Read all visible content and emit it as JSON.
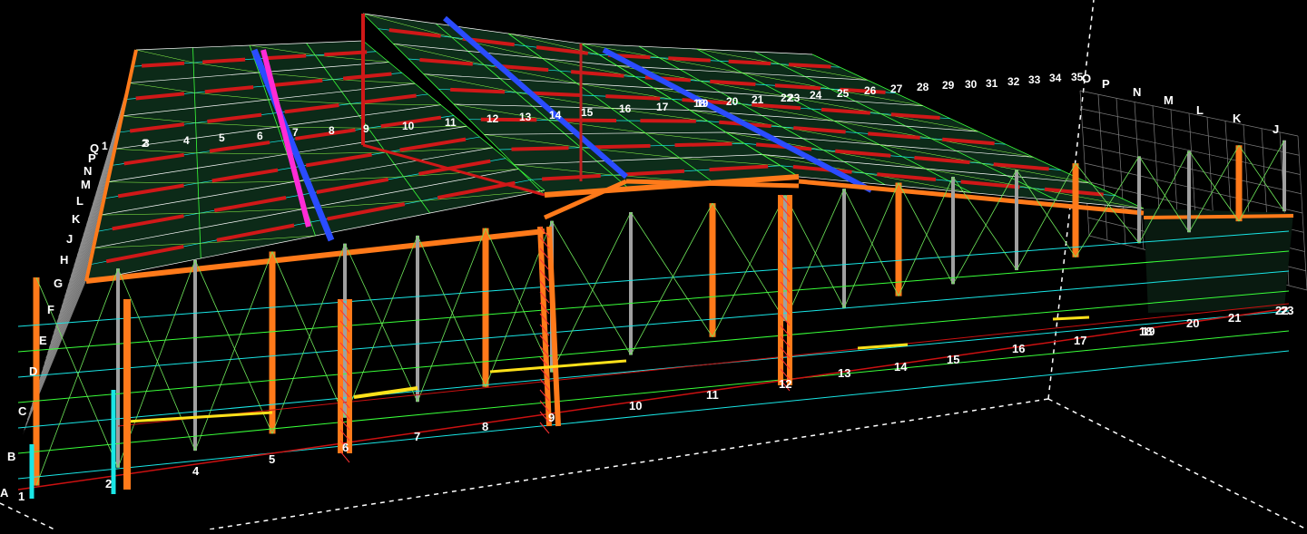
{
  "view": {
    "background": "#000000",
    "label_color": "#ffffff",
    "member_colors": {
      "columns_primary": "#ff7a1a",
      "columns_secondary": "#a0a0a0",
      "bracing": "#39ff39",
      "purlins": "#19e6e6",
      "roof_units": "#d01818",
      "crane_beam": "#2a4cff",
      "tie_members": "#ff2bd6",
      "rails": "#ffe11a",
      "ground_lines": "#cc1111",
      "cladding_grey": "#9a9a9a"
    }
  },
  "grid": {
    "front_axis_labels": [
      "1",
      "2",
      "4",
      "5",
      "6",
      "7",
      "8",
      "9",
      "10",
      "11",
      "12",
      "13",
      "14",
      "15",
      "16",
      "17",
      "18",
      "19",
      "20",
      "21",
      "22",
      "23"
    ],
    "roof_axis_labels": [
      "1",
      "2",
      "3",
      "4",
      "5",
      "6",
      "7",
      "8",
      "9",
      "10",
      "11",
      "12",
      "13",
      "14",
      "15",
      "16",
      "17",
      "18",
      "19",
      "20",
      "21",
      "22",
      "23",
      "24",
      "25",
      "26",
      "27",
      "28",
      "29",
      "30",
      "31",
      "32",
      "33",
      "34",
      "35"
    ],
    "left_row_labels": [
      "A",
      "B",
      "C",
      "D",
      "E",
      "F",
      "G",
      "H",
      "J",
      "K",
      "L",
      "M",
      "N",
      "P",
      "Q"
    ],
    "right_row_labels": [
      "O",
      "P",
      "N",
      "M",
      "L",
      "K",
      "J"
    ]
  }
}
